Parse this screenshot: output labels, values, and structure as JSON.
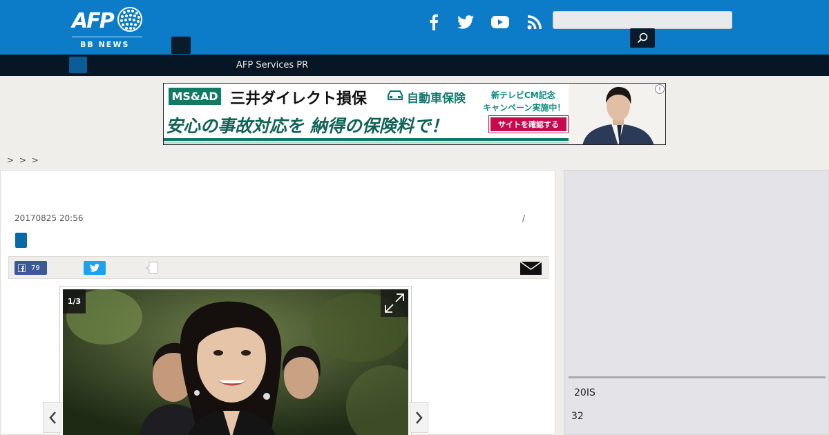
{
  "header": {
    "logo_text": "AFP",
    "logo_subtitle": "BB NEWS",
    "social_icons": [
      "facebook-icon",
      "twitter-icon",
      "youtube-icon",
      "rss-icon"
    ],
    "search_placeholder": "",
    "search_icon": "search-icon",
    "brand_color": "#0c7cc8"
  },
  "nav": {
    "items": [
      {
        "label": "AFP Services PR"
      }
    ]
  },
  "ad": {
    "logo": "MS&AD",
    "brand": "三井ダイレクト損保",
    "product": "自動車保険",
    "campaign_line1": "新テレビCM記念",
    "campaign_line2": "キャンペーン実施中！",
    "headline": "安心の事故対応を 納得の保険料で！",
    "cta": "サイトを確認する"
  },
  "breadcrumb": "> > >",
  "article": {
    "date": "20170825 20:56",
    "slash": "/",
    "share": {
      "facebook_count": "79"
    },
    "gallery": {
      "counter": "1/3"
    }
  },
  "sidebar": {
    "text1": "20IS",
    "text2": "32"
  }
}
